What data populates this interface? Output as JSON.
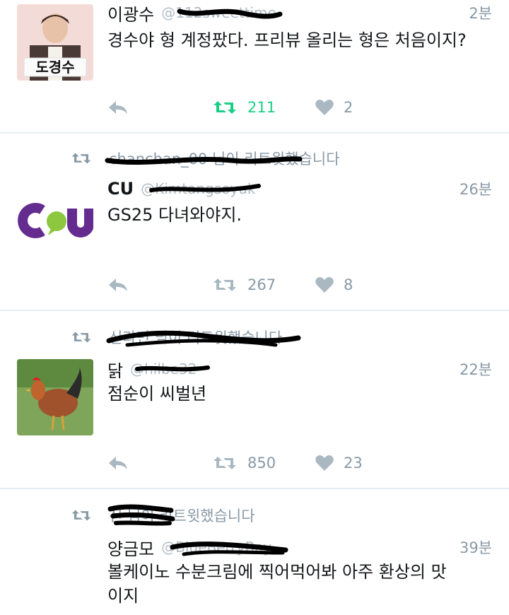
{
  "tweets": [
    {
      "retweeted_by": "",
      "name": "이광수",
      "handle": "@112sweettime",
      "time": "2분",
      "text": "경수야 형 계정팠다. 프리뷰 올리는 형은 처음이지?",
      "retweets": "211",
      "likes": "2",
      "avatar_sign": "도경수"
    },
    {
      "retweeted_by": "chanchan_00 님이 리트윗했습니다",
      "name": "CU",
      "handle": "@Kimtangsoyuk",
      "time": "26분",
      "text": "GS25 다녀와야지.",
      "retweets": "267",
      "likes": "8"
    },
    {
      "retweeted_by": "신라면 님이 리트윗했습니다",
      "name": "닭",
      "handle": "@hilbe32",
      "time": "22분",
      "text": "점순이 씨벌년",
      "retweets": "850",
      "likes": "23"
    },
    {
      "retweeted_by": "신 님이 리트윗했습니다",
      "name": "양금모",
      "handle": "@BlueBerryBoy",
      "time": "39분",
      "text": "볼케이노 수분크림에 찍어먹어봐 아주 환상의 맛이지"
    }
  ],
  "colors": {
    "retweet_active": "#19cf86",
    "icon": "#aab8c2",
    "muted": "#8899a6",
    "cu_purple": "#652c90",
    "cu_green": "#8dc63f"
  }
}
